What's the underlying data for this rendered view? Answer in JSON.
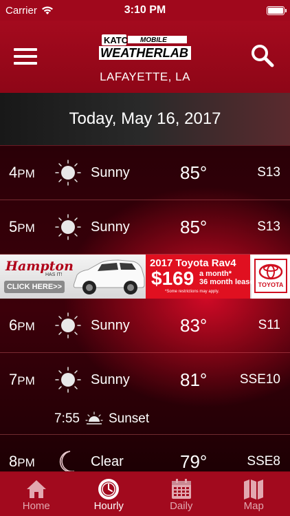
{
  "status_bar": {
    "carrier": "Carrier",
    "time": "3:10 PM"
  },
  "header": {
    "logo_station": "KATC3",
    "logo_mobile": "MOBILE",
    "logo_brand": "WEATHERLAB",
    "location": "LAFAYETTE, LA"
  },
  "date_label": "Today, May 16, 2017",
  "hours": [
    {
      "time": "4",
      "ampm": "PM",
      "icon": "sun-icon",
      "condition": "Sunny",
      "temp": "85°",
      "wind": "S13"
    },
    {
      "time": "5",
      "ampm": "PM",
      "icon": "sun-icon",
      "condition": "Sunny",
      "temp": "85°",
      "wind": "S13"
    },
    {
      "time": "6",
      "ampm": "PM",
      "icon": "sun-icon",
      "condition": "Sunny",
      "temp": "83°",
      "wind": "S11"
    },
    {
      "time": "7",
      "ampm": "PM",
      "icon": "sun-icon",
      "condition": "Sunny",
      "temp": "81°",
      "wind": "SSE10"
    },
    {
      "time": "8",
      "ampm": "PM",
      "icon": "moon-icon",
      "condition": "Clear",
      "temp": "79°",
      "wind": "SSE8"
    }
  ],
  "sunset": {
    "time": "7:55",
    "label": "Sunset",
    "icon": "sunset-icon"
  },
  "ad": {
    "brand": "Hampton",
    "brand_sub": "HAS IT!",
    "button": "CLICK HERE>>",
    "title": "2017 Toyota Rav4",
    "price": "$169",
    "month": "a month*",
    "lease": "36 month lease",
    "restrictions": "*Some restrictions may apply.",
    "toyota": "TOYOTA"
  },
  "tabs": [
    {
      "label": "Home",
      "icon": "home-icon",
      "active": false
    },
    {
      "label": "Hourly",
      "icon": "clock-icon",
      "active": true
    },
    {
      "label": "Daily",
      "icon": "calendar-icon",
      "active": false
    },
    {
      "label": "Map",
      "icon": "map-icon",
      "active": false
    }
  ],
  "colors": {
    "header_red": "#a40a1e",
    "tab_red": "#a20a1e",
    "ad_red": "#e01020"
  }
}
